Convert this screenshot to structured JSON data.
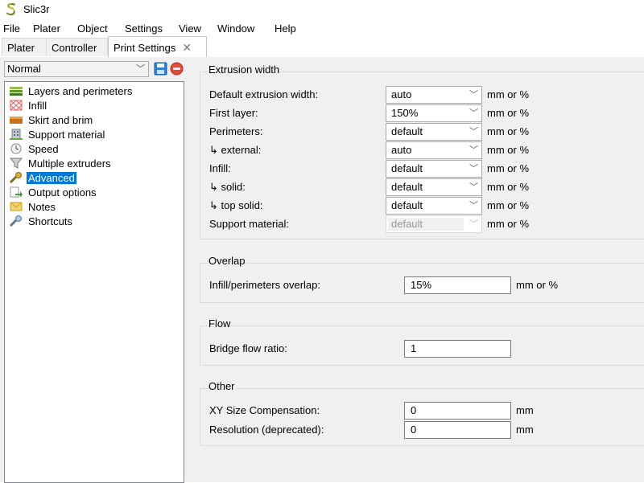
{
  "window": {
    "title": "Slic3r"
  },
  "menu": [
    "File",
    "Plater",
    "Object",
    "Settings",
    "View",
    "Window",
    "Help"
  ],
  "tabs": [
    {
      "label": "Plater"
    },
    {
      "label": "Controller"
    },
    {
      "label": "Print Settings",
      "close": "✕"
    }
  ],
  "preset": {
    "selected": "Normal"
  },
  "tree": [
    {
      "label": "Layers and perimeters",
      "icon": "layers-icon"
    },
    {
      "label": "Infill",
      "icon": "infill-icon"
    },
    {
      "label": "Skirt and brim",
      "icon": "skirt-icon"
    },
    {
      "label": "Support material",
      "icon": "building-icon"
    },
    {
      "label": "Speed",
      "icon": "clock-icon"
    },
    {
      "label": "Multiple extruders",
      "icon": "funnel-icon"
    },
    {
      "label": "Advanced",
      "icon": "wrench-icon",
      "selected": true
    },
    {
      "label": "Output options",
      "icon": "output-icon"
    },
    {
      "label": "Notes",
      "icon": "note-icon"
    },
    {
      "label": "Shortcuts",
      "icon": "wrench2-icon"
    }
  ],
  "extrusion_width": {
    "title": "Extrusion width",
    "rows": [
      {
        "label": "Default extrusion width:",
        "value": "auto",
        "unit": "mm or %"
      },
      {
        "label": "First layer:",
        "value": "150%",
        "unit": "mm or %"
      },
      {
        "label": "Perimeters:",
        "value": "default",
        "unit": "mm or %"
      },
      {
        "label": "↳ external:",
        "value": "auto",
        "unit": "mm or %"
      },
      {
        "label": "Infill:",
        "value": "default",
        "unit": "mm or %"
      },
      {
        "label": "↳ solid:",
        "value": "default",
        "unit": "mm or %"
      },
      {
        "label": "↳ top solid:",
        "value": "default",
        "unit": "mm or %"
      },
      {
        "label": "Support material:",
        "value": "default",
        "unit": "mm or %",
        "disabled": true
      }
    ]
  },
  "overlap": {
    "title": "Overlap",
    "label": "Infill/perimeters overlap:",
    "value": "15%",
    "unit": "mm or %"
  },
  "flow": {
    "title": "Flow",
    "label": "Bridge flow ratio:",
    "value": "1"
  },
  "other": {
    "title": "Other",
    "rows": [
      {
        "label": "XY Size Compensation:",
        "value": "0",
        "unit": "mm"
      },
      {
        "label": "Resolution (deprecated):",
        "value": "0",
        "unit": "mm"
      }
    ]
  },
  "colors": {
    "selection": "#0078d7",
    "panel": "#f0f0f0"
  }
}
